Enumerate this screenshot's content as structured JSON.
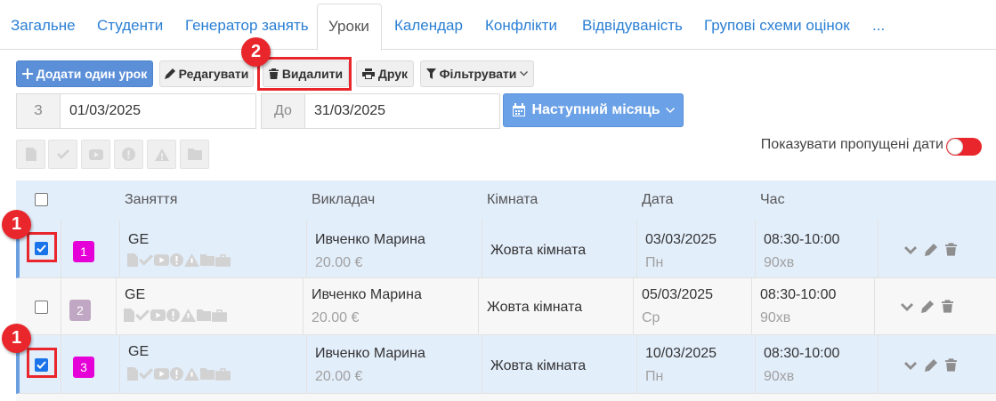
{
  "tabs": [
    {
      "label": "Загальне"
    },
    {
      "label": "Студенти"
    },
    {
      "label": "Генератор занять"
    },
    {
      "label": "Уроки"
    },
    {
      "label": "Календар"
    },
    {
      "label": "Конфлікти"
    },
    {
      "label": "Відвідуваність"
    },
    {
      "label": "Групові схеми оцінок"
    },
    {
      "label": "..."
    }
  ],
  "active_tab": "Уроки",
  "toolbar": {
    "add_label": "Додати один урок",
    "edit_label": "Редагувати",
    "delete_label": "Видалити",
    "print_label": "Друк",
    "filter_label": "Фільтрувати"
  },
  "date_range": {
    "from_label": "З",
    "from_value": "01/03/2025",
    "to_label": "До",
    "to_value": "31/03/2025",
    "next_month_label": "Наступний місяць"
  },
  "show_missed_dates": {
    "label": "Показувати пропущені дати",
    "enabled": true
  },
  "table": {
    "headers": {
      "lesson": "Заняття",
      "teacher": "Викладач",
      "room": "Кімната",
      "date": "Дата",
      "time": "Час"
    },
    "rows": [
      {
        "checked": true,
        "number": "1",
        "badge_color": "#e600d8",
        "lesson": "GE",
        "teacher": "Ивченко Марина",
        "price": "20.00 €",
        "room": "Жовта кімната",
        "date": "03/03/2025",
        "weekday": "Пн",
        "time": "08:30-10:00",
        "duration": "90хв"
      },
      {
        "checked": false,
        "number": "2",
        "badge_color": "#c0a7c3",
        "lesson": "GE",
        "teacher": "Ивченко Марина",
        "price": "20.00 €",
        "room": "Жовта кімната",
        "date": "05/03/2025",
        "weekday": "Ср",
        "time": "08:30-10:00",
        "duration": "90хв"
      },
      {
        "checked": true,
        "number": "3",
        "badge_color": "#e600d8",
        "lesson": "GE",
        "teacher": "Ивченко Марина",
        "price": "20.00 €",
        "room": "Жовта кімната",
        "date": "10/03/2025",
        "weekday": "Пн",
        "time": "08:30-10:00",
        "duration": "90хв"
      }
    ]
  },
  "annotations": {
    "step1": "1",
    "step2": "2"
  },
  "colors": {
    "link": "#2a7fd4",
    "primary": "#5b8fd8",
    "highlight": "#e8262b",
    "selected_row": "#e3eefb"
  }
}
